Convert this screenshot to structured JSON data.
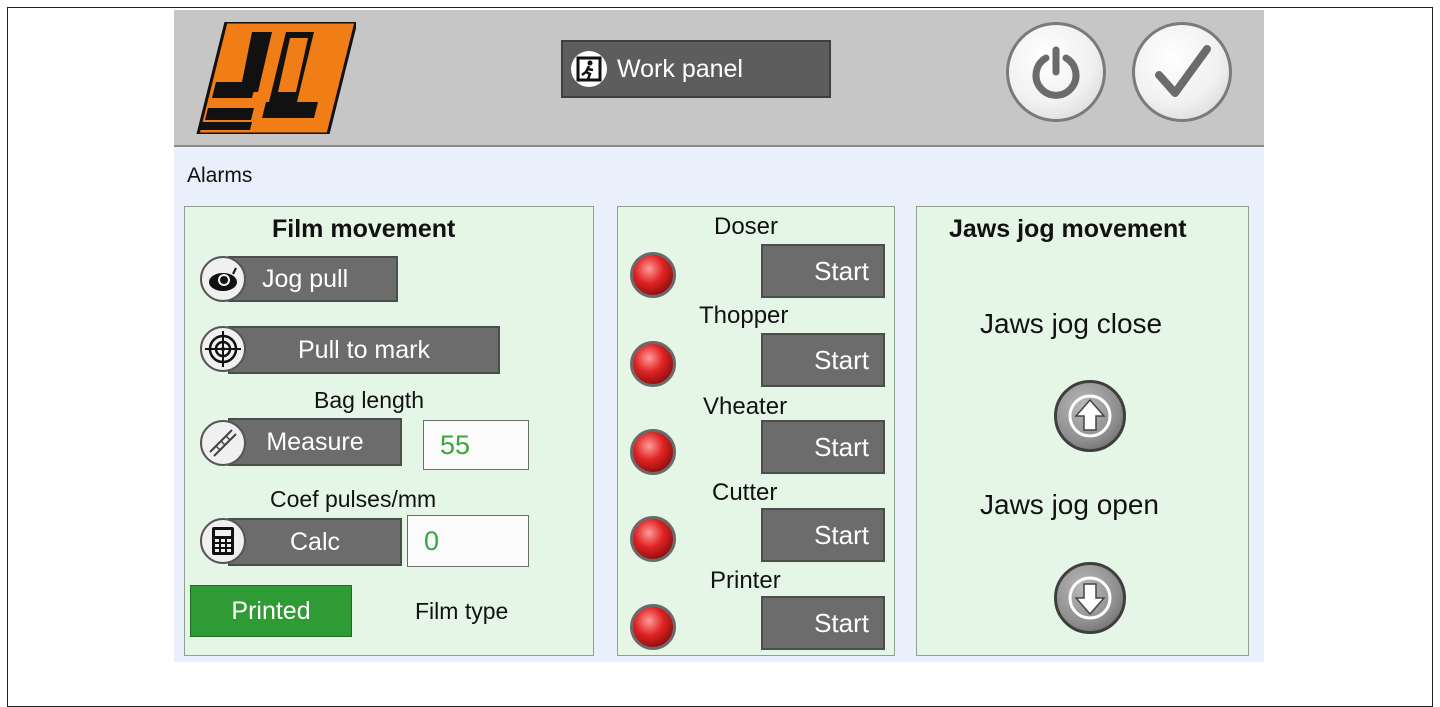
{
  "header": {
    "work_panel_label": "Work panel"
  },
  "alarms_label": "Alarms",
  "film_movement": {
    "title": "Film movement",
    "jog_pull_label": "Jog pull",
    "pull_to_mark_label": "Pull to mark",
    "bag_length_label": "Bag length",
    "measure_label": "Measure",
    "bag_length_value": "55",
    "coef_label": "Coef pulses/mm",
    "calc_label": "Calc",
    "coef_value": "0",
    "printed_label": "Printed",
    "film_type_label": "Film type"
  },
  "devices": [
    {
      "name": "Doser",
      "button": "Start"
    },
    {
      "name": "Thopper",
      "button": "Start"
    },
    {
      "name": "Vheater",
      "button": "Start"
    },
    {
      "name": "Cutter",
      "button": "Start"
    },
    {
      "name": "Printer",
      "button": "Start"
    }
  ],
  "jaws": {
    "title": "Jaws jog movement",
    "close_label": "Jaws jog close",
    "open_label": "Jaws jog open"
  },
  "colors": {
    "led_off_red": "#e02424",
    "printed_green": "#2f9b34",
    "value_green": "#39a839"
  },
  "icons": {
    "power": "power-icon",
    "check": "check-icon",
    "exit": "exit-icon",
    "snail": "snail-icon",
    "target": "target-icon",
    "ruler": "ruler-icon",
    "calculator": "calculator-icon",
    "arrow_up": "arrow-up-icon",
    "arrow_down": "arrow-down-icon"
  }
}
